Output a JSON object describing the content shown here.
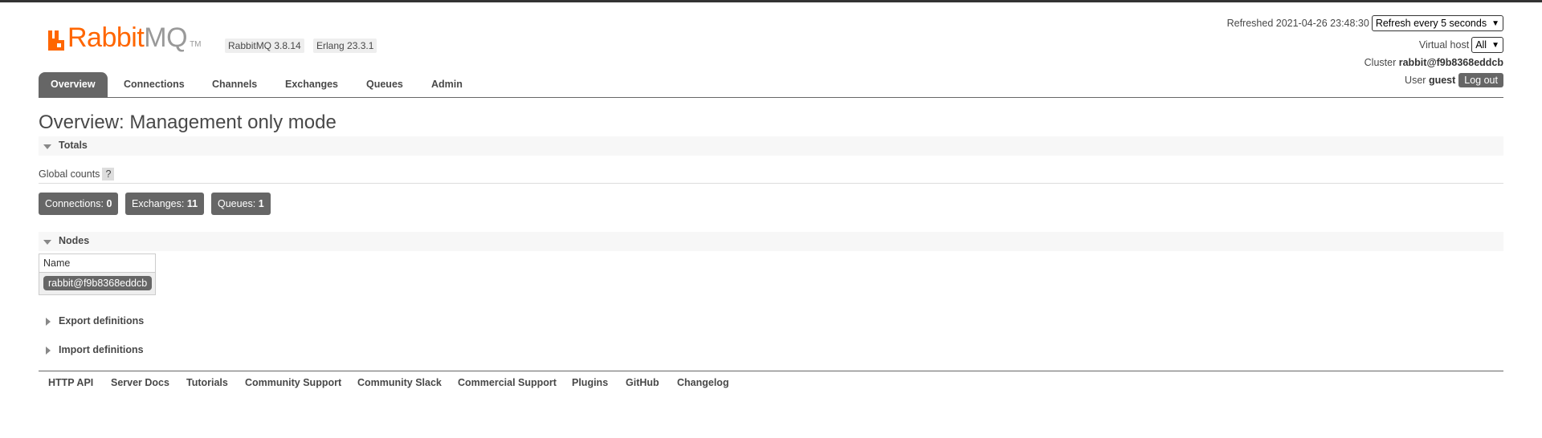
{
  "header": {
    "logo_rabbit": "Rabbit",
    "logo_mq": "MQ",
    "logo_tm": "TM",
    "rabbitmq_version": "RabbitMQ 3.8.14",
    "erlang_version": "Erlang 23.3.1",
    "refreshed_label": "Refreshed 2021-04-26 23:48:30",
    "refresh_select": "Refresh every 5 seconds",
    "vhost_label": "Virtual host",
    "vhost_select": "All",
    "cluster_label": "Cluster",
    "cluster_name": "rabbit@f9b8368eddcb",
    "user_label": "User",
    "user_name": "guest",
    "logout_label": "Log out"
  },
  "tabs": [
    "Overview",
    "Connections",
    "Channels",
    "Exchanges",
    "Queues",
    "Admin"
  ],
  "page_title": "Overview: Management only mode",
  "totals": {
    "title": "Totals",
    "global_counts_label": "Global counts",
    "help": "?",
    "connections_label": "Connections:",
    "connections_value": "0",
    "exchanges_label": "Exchanges:",
    "exchanges_value": "11",
    "queues_label": "Queues:",
    "queues_value": "1"
  },
  "nodes": {
    "title": "Nodes",
    "column_name": "Name",
    "rows": [
      "rabbit@f9b8368eddcb"
    ]
  },
  "export_definitions": "Export definitions",
  "import_definitions": "Import definitions",
  "footer": [
    "HTTP API",
    "Server Docs",
    "Tutorials",
    "Community Support",
    "Community Slack",
    "Commercial Support",
    "Plugins",
    "GitHub",
    "Changelog"
  ],
  "colors": {
    "brand_orange": "#ff6600",
    "tab_active": "#666666",
    "text": "#484848"
  }
}
